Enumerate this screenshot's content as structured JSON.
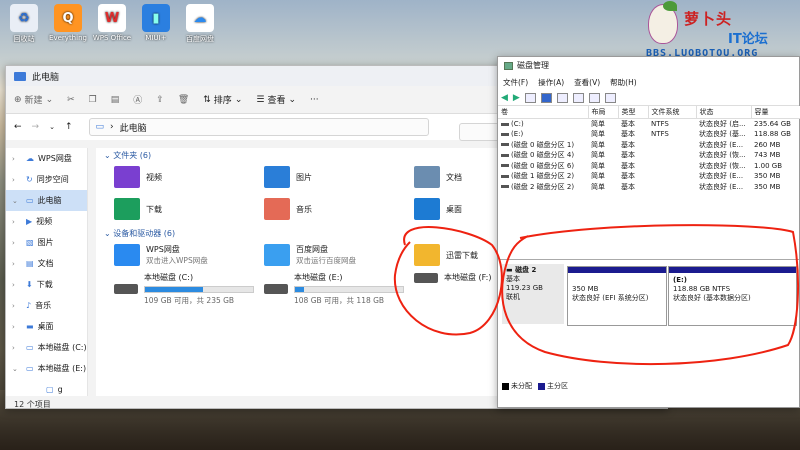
{
  "desktop": [
    {
      "label": "回收站",
      "color": "#e9eef6",
      "glyph": "♻",
      "fg": "#2a6fd6"
    },
    {
      "label": "Everything",
      "color": "#ff9422",
      "glyph": "Q",
      "fg": "#fff"
    },
    {
      "label": "WPS Office",
      "color": "#fff",
      "glyph": "W",
      "fg": "#e02b2b"
    },
    {
      "label": "MIUI+",
      "color": "#2b7fe0",
      "glyph": "▮",
      "fg": "#8fe"
    },
    {
      "label": "百度网盘",
      "color": "#fff",
      "glyph": "☁",
      "fg": "#2a8af0"
    }
  ],
  "logo": {
    "t1": "萝卜头",
    "t2": "IT论坛",
    "t3": "BBS.LUOBOTOU.ORG"
  },
  "explorer": {
    "title": "此电脑",
    "toolbar": {
      "new": "新建",
      "sort": "排序",
      "view": "查看"
    },
    "address": "此电脑",
    "sidebar": [
      {
        "label": "WPS网盘",
        "chev": "›",
        "sel": false
      },
      {
        "label": "同步空间",
        "chev": "›",
        "sel": false
      },
      {
        "label": "此电脑",
        "chev": "⌄",
        "sel": true
      },
      {
        "label": "视频",
        "chev": "›",
        "sel": false
      },
      {
        "label": "图片",
        "chev": "›",
        "sel": false
      },
      {
        "label": "文档",
        "chev": "›",
        "sel": false
      },
      {
        "label": "下载",
        "chev": "›",
        "sel": false
      },
      {
        "label": "音乐",
        "chev": "›",
        "sel": false
      },
      {
        "label": "桌面",
        "chev": "›",
        "sel": false
      },
      {
        "label": "本地磁盘 (C:)",
        "chev": "›",
        "sel": false
      },
      {
        "label": "本地磁盘 (E:)",
        "chev": "⌄",
        "sel": false
      },
      {
        "label": "g",
        "chev": "",
        "sel": false
      }
    ],
    "folders_header": "文件夹 (6)",
    "folders": [
      {
        "label": "视频",
        "color": "#7a3fd0"
      },
      {
        "label": "图片",
        "color": "#2a7ed8"
      },
      {
        "label": "文档",
        "color": "#6b8db0"
      },
      {
        "label": "下载",
        "color": "#1c9e5d"
      },
      {
        "label": "音乐",
        "color": "#e46a56"
      },
      {
        "label": "桌面",
        "color": "#1d7bd3"
      }
    ],
    "devices_header": "设备和驱动器 (6)",
    "devices": [
      {
        "label": "WPS网盘",
        "sub": "双击进入WPS网盘"
      },
      {
        "label": "百度网盘",
        "sub": "双击运行百度网盘"
      },
      {
        "label": "迅雷下载",
        "sub": ""
      }
    ],
    "drives": [
      {
        "label": "本地磁盘 (C:)",
        "size": "109 GB 可用，共 235 GB",
        "used": 0.54
      },
      {
        "label": "本地磁盘 (E:)",
        "size": "108 GB 可用，共 118 GB",
        "used": 0.08
      },
      {
        "label": "本地磁盘 (F:)",
        "size": "",
        "used": null
      }
    ],
    "status": "12 个项目"
  },
  "disk_mgmt": {
    "title": "磁盘管理",
    "menu": [
      "文件(F)",
      "操作(A)",
      "查看(V)",
      "帮助(H)"
    ],
    "columns": [
      "卷",
      "布局",
      "类型",
      "文件系统",
      "状态",
      "容量"
    ],
    "rows": [
      [
        "(C:)",
        "简单",
        "基本",
        "NTFS",
        "状态良好 (启...",
        "235.64 GB"
      ],
      [
        "(E:)",
        "简单",
        "基本",
        "NTFS",
        "状态良好 (基...",
        "118.88 GB"
      ],
      [
        "(磁盘 0 磁盘分区 1)",
        "简单",
        "基本",
        "",
        "状态良好 (E...",
        "260 MB"
      ],
      [
        "(磁盘 0 磁盘分区 4)",
        "简单",
        "基本",
        "",
        "状态良好 (恢...",
        "743 MB"
      ],
      [
        "(磁盘 0 磁盘分区 6)",
        "简单",
        "基本",
        "",
        "状态良好 (恢...",
        "1.00 GB"
      ],
      [
        "(磁盘 1 磁盘分区 2)",
        "简单",
        "基本",
        "",
        "状态良好 (E...",
        "350 MB"
      ],
      [
        "(磁盘 2 磁盘分区 2)",
        "简单",
        "基本",
        "",
        "状态良好 (E...",
        "350 MB"
      ]
    ],
    "disk": {
      "name": "磁盘 2",
      "type": "基本",
      "size": "119.23 GB",
      "state": "联机"
    },
    "partitions": [
      {
        "l1": "350 MB",
        "l2": "状态良好 (EFI 系统分区)"
      },
      {
        "l0": "(E:)",
        "l1": "118.88 GB NTFS",
        "l2": "状态良好 (基本数据分区)"
      }
    ],
    "legend": [
      "未分配",
      "主分区"
    ]
  }
}
